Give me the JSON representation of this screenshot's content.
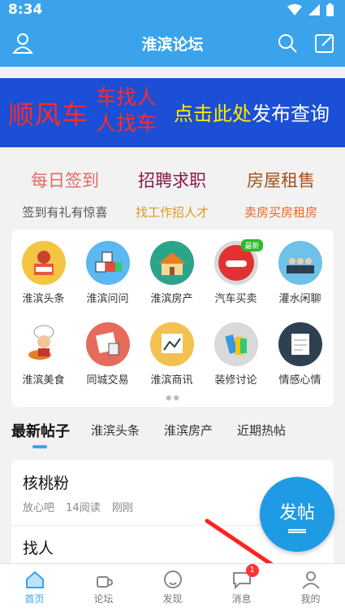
{
  "status": {
    "time": "8:34"
  },
  "header": {
    "title": "淮滨论坛"
  },
  "banner": {
    "left": "顺风车",
    "mid_line1": "车找人",
    "mid_line2": "人找车",
    "right_yellow": "点击此处",
    "right_white": "发布查询"
  },
  "promo": [
    {
      "title": "每日签到",
      "subtitle": "签到有礼有惊喜",
      "title_color": "#e06a6a",
      "subtitle_color": "#555555"
    },
    {
      "title": "招聘求职",
      "subtitle": "找工作招人才",
      "title_color": "#8b1a4a",
      "subtitle_color": "#d79a22"
    },
    {
      "title": "房屋租售",
      "subtitle": "卖房买房租房",
      "title_color": "#a3521a",
      "subtitle_color": "#e26a2c"
    }
  ],
  "grid": [
    {
      "label": "淮滨头条",
      "icon": "reader-icon",
      "color": "#f4c542"
    },
    {
      "label": "淮滨问问",
      "icon": "blocks-icon",
      "color": "#5bb8f0"
    },
    {
      "label": "淮滨房产",
      "icon": "house-icon",
      "color": "#2aa58a"
    },
    {
      "label": "汽车买卖",
      "icon": "car-icon",
      "color": "#d8d8d8",
      "badge": "最新"
    },
    {
      "label": "灌水闲聊",
      "icon": "chat-group-icon",
      "color": "#6cc2e8"
    },
    {
      "label": "淮滨美食",
      "icon": "chef-icon",
      "color": "#ffffff"
    },
    {
      "label": "同城交易",
      "icon": "trade-icon",
      "color": "#e66b5b"
    },
    {
      "label": "淮滨商讯",
      "icon": "business-chart-icon",
      "color": "#f2c14e"
    },
    {
      "label": "装修讨论",
      "icon": "decor-icon",
      "color": "#d9d9d9"
    },
    {
      "label": "情感心情",
      "icon": "note-icon",
      "color": "#2f4050"
    }
  ],
  "tabs": [
    "最新帖子",
    "淮滨头条",
    "淮滨房产",
    "近期热帖"
  ],
  "posts": [
    {
      "title": "核桃粉",
      "meta": [
        "放心吧",
        "14阅读",
        "刚刚"
      ]
    },
    {
      "title": "找人"
    }
  ],
  "fab": {
    "label": "发帖"
  },
  "bottom_nav": [
    {
      "label": "首页",
      "icon": "home-icon"
    },
    {
      "label": "论坛",
      "icon": "coffee-icon"
    },
    {
      "label": "发现",
      "icon": "discover-icon"
    },
    {
      "label": "消息",
      "icon": "message-icon",
      "badge": "1"
    },
    {
      "label": "我的",
      "icon": "profile-icon"
    }
  ],
  "colors": {
    "primary": "#3aa3ec",
    "banner_bg": "#1a4fd6"
  }
}
